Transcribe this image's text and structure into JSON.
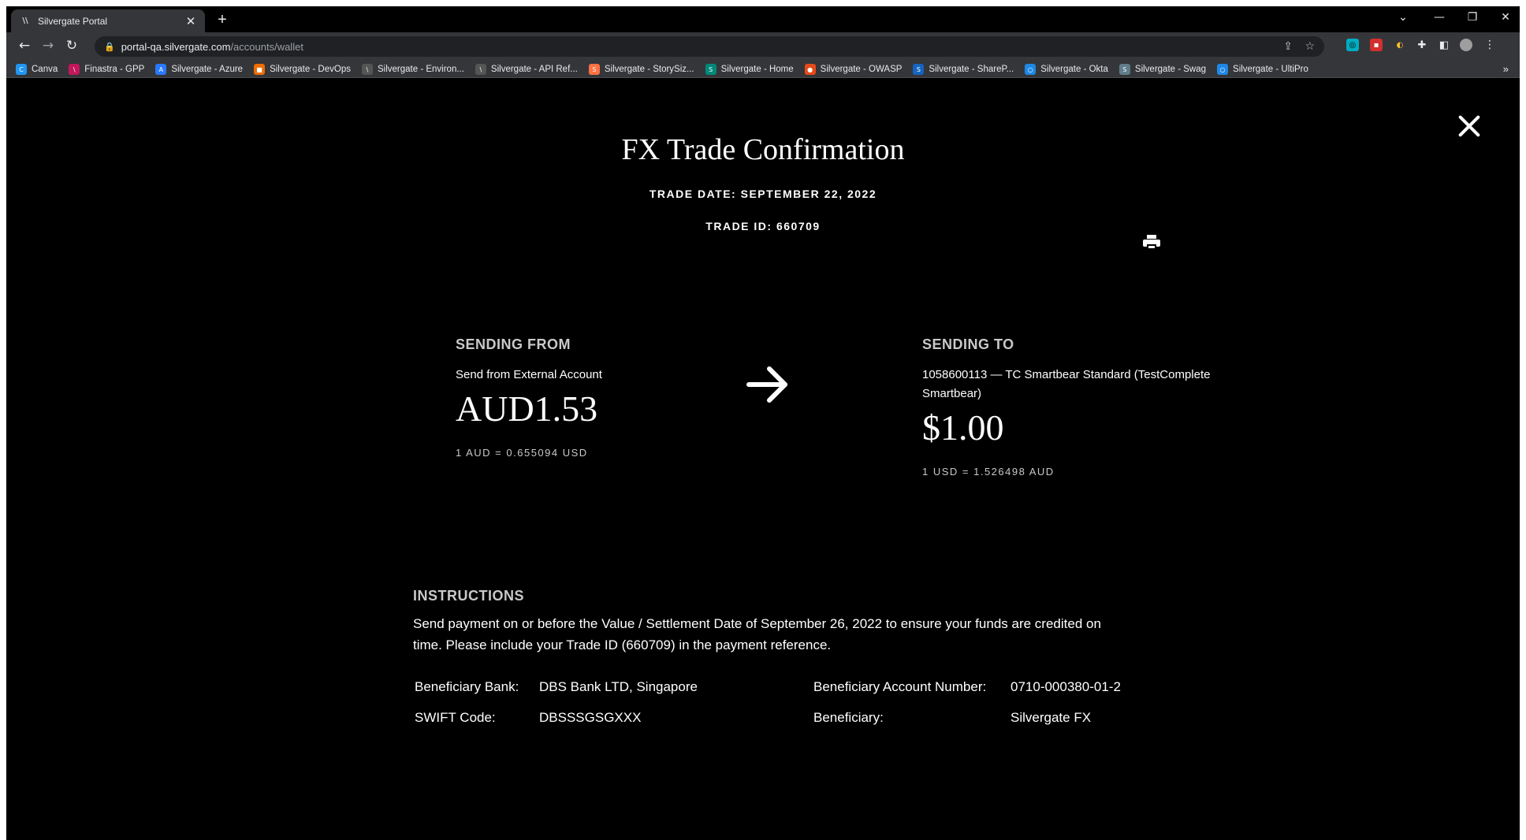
{
  "browser": {
    "tab_title": "Silvergate Portal",
    "tab_close": "✕",
    "new_tab": "+",
    "url_host": "portal-qa.silvergate.com",
    "url_path": "/accounts/wallet",
    "window_controls": [
      "⌄",
      "—",
      "❐",
      "✕"
    ],
    "bookmarks": [
      {
        "label": "Canva",
        "color": "#2196f3",
        "glyph": "C"
      },
      {
        "label": "Finastra - GPP",
        "color": "#c2185b",
        "glyph": "\\"
      },
      {
        "label": "Silvergate - Azure",
        "color": "#2979ff",
        "glyph": "A"
      },
      {
        "label": "Silvergate - DevOps",
        "color": "#ef6c00",
        "glyph": "■"
      },
      {
        "label": "Silvergate - Environ...",
        "color": "#555555",
        "glyph": "\\"
      },
      {
        "label": "Silvergate - API Ref...",
        "color": "#555555",
        "glyph": "\\"
      },
      {
        "label": "Silvergate - StorySiz...",
        "color": "#ff7043",
        "glyph": "S"
      },
      {
        "label": "Silvergate - Home",
        "color": "#00897b",
        "glyph": "S"
      },
      {
        "label": "Silvergate - OWASP",
        "color": "#e64a19",
        "glyph": "●"
      },
      {
        "label": "Silvergate - ShareP...",
        "color": "#1565c0",
        "glyph": "S"
      },
      {
        "label": "Silvergate - Okta",
        "color": "#1e88e5",
        "glyph": "○"
      },
      {
        "label": "Silvergate - Swag",
        "color": "#607d8b",
        "glyph": "S"
      },
      {
        "label": "Silvergate - UltiPro",
        "color": "#1e88e5",
        "glyph": "○"
      }
    ],
    "bookmarks_more": "»"
  },
  "page": {
    "title": "FX Trade Confirmation",
    "trade_date": "TRADE DATE: SEPTEMBER 22, 2022",
    "trade_id": "TRADE ID: 660709",
    "from": {
      "label": "SENDING FROM",
      "desc": "Send from External Account",
      "amount": "AUD1.53",
      "rate": "1 AUD = 0.655094 USD"
    },
    "to": {
      "label": "SENDING TO",
      "desc_line1": "1058600113 — TC Smartbear Standard (TestComplete",
      "desc_line2": "Smartbear)",
      "amount": "$1.00",
      "rate": "1 USD = 1.526498 AUD"
    },
    "instructions": {
      "label": "INSTRUCTIONS",
      "text_line1": "Send payment on or before the Value / Settlement Date of September 26, 2022 to ensure your funds are credited on",
      "text_line2": "time. Please include your Trade ID (660709) in the payment reference.",
      "beneficiary_bank_label": "Beneficiary Bank:",
      "beneficiary_bank": "DBS Bank LTD, Singapore",
      "swift_label": "SWIFT Code:",
      "swift": "DBSSSGSGXXX",
      "account_number_label": "Beneficiary Account Number:",
      "account_number": "0710-000380-01-2",
      "beneficiary_label": "Beneficiary:",
      "beneficiary": "Silvergate FX"
    }
  }
}
